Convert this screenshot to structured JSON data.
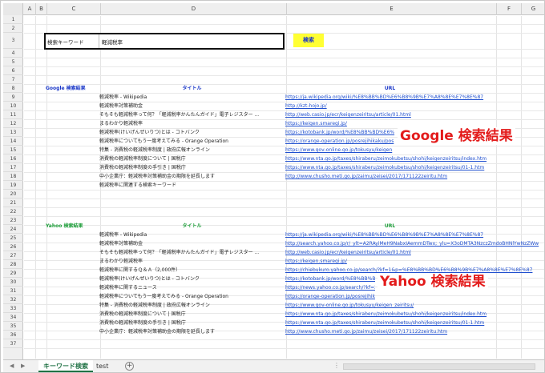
{
  "columns": [
    "A",
    "B",
    "C",
    "D",
    "E",
    "F",
    "G"
  ],
  "rows": [
    "1",
    "2",
    "3",
    "4",
    "5",
    "6",
    "7",
    "8",
    "9",
    "10",
    "11",
    "12",
    "13",
    "14",
    "15",
    "16",
    "17",
    "18",
    "19",
    "20",
    "21",
    "22",
    "23",
    "24",
    "25",
    "26",
    "27",
    "28",
    "29",
    "30",
    "31",
    "32",
    "33",
    "34",
    "35",
    "36",
    "37"
  ],
  "search": {
    "label": "検索キーワード",
    "value": "軽減税率",
    "button_label": "検索"
  },
  "google": {
    "section_label": "Google 検索結果",
    "title_header": "タイトル",
    "url_header": "URL",
    "overlay_label": "Google 検索結果",
    "results": [
      {
        "title": "軽減税率 - Wikipedia",
        "url": "https://ja.wikipedia.org/wiki/%E8%BB%BD%E6%B8%9B%E7%A8%8E%E7%8E%87"
      },
      {
        "title": "軽減税率対策補助金",
        "url": "http://kzt-hojo.jp/"
      },
      {
        "title": "そもそも軽減税率って何？「軽減税率かんたんガイド」電子レジスター ...",
        "url": "http://web.casio.jp/ecr/keigenzeiritsu/article/01.html"
      },
      {
        "title": "まるわかり軽減税率",
        "url": "https://keigen.smaregi.jp/"
      },
      {
        "title": "軽減税率(けいげんぜいりつ)とは - コトバンク",
        "url": "https://kotobank.jp/word/%E8%BB%BD%E6%"
      },
      {
        "title": "軽減税率についてもう一度考えてみる - Orange Operation",
        "url": "https://orange-operation.jp/posrejihikaku/pos"
      },
      {
        "title": "特集 - 消費税の軽減税率制度 | 政府広報オンライン",
        "url": "https://www.gov-online.go.jp/tokusyu/keigen"
      },
      {
        "title": "消費税の軽減税率制度について | 国税庁",
        "url": "https://www.nta.go.jp/taxes/shiraberu/zeimokubetsu/shohi/keigenzeiritsu/index.htm"
      },
      {
        "title": "消費税の軽減税率制度の手引き | 国税庁",
        "url": "https://www.nta.go.jp/taxes/shiraberu/zeimokubetsu/shohi/keigenzeiritsu/01-1.htm"
      },
      {
        "title": "中小企業庁：軽減税率対策補助金の期限を延長します",
        "url": "http://www.chusho.meti.go.jp/zaimu/zeisei/2017/171122zeiritu.htm"
      },
      {
        "title": "軽減税率に関連する検索キーワード",
        "url": ""
      }
    ]
  },
  "yahoo": {
    "section_label": "Yahoo 検索結果",
    "title_header": "タイトル",
    "url_header": "URL",
    "overlay_label": "Yahoo 検索結果",
    "results": [
      {
        "title": "軽減税率 - Wikipedia",
        "url": "https://ja.wikipedia.org/wiki/%E8%BB%BD%E6%B8%9B%E7%A8%8E%E7%8E%87"
      },
      {
        "title": "軽減税率対策補助金",
        "url": "http://search.yahoo.co.jp/r/_ylt=A2RAyiMeH9NabxIAemmDTwx;_ylu=X3oDMTA3NzczZmdoBHNlYwNzZWw"
      },
      {
        "title": "そもそも軽減税率って何？「軽減税率かんたんガイド」電子レジスター ...",
        "url": "http://web.casio.jp/ecr/keigenzeiritsu/article/01.html"
      },
      {
        "title": "まるわかり軽減税率",
        "url": "https://keigen.smaregi.jp/"
      },
      {
        "title": "軽減税率に関するＱ＆Ａ（2,000件）",
        "url": "https://chiebukuro.yahoo.co.jp/search/?kf=1&p=%E8%BB%BD%E6%B8%9B%E7%A8%8E%E7%8E%87"
      },
      {
        "title": "軽減税率(けいげんぜいりつ)とは - コトバンク",
        "url": "https://kotobank.jp/word/%E8%BB%BD"
      },
      {
        "title": "軽減税率に関するニュース",
        "url": "https://news.yahoo.co.jp/search/?kf=2&ei"
      },
      {
        "title": "軽減税率についてもう一度考えてみる - Orange Operation",
        "url": "https://orange-operation.jp/posrejihikaku/po"
      },
      {
        "title": "特集 - 消費税の軽減税率制度 | 政府広報オンライン",
        "url": "https://www.gov-online.go.jp/tokusyu/keigen_zeiritsu/"
      },
      {
        "title": "消費税の軽減税率制度について | 国税庁",
        "url": "https://www.nta.go.jp/taxes/shiraberu/zeimokubetsu/shohi/keigenzeiritsu/index.htm"
      },
      {
        "title": "消費税の軽減税率制度の手引き | 国税庁",
        "url": "https://www.nta.go.jp/taxes/shiraberu/zeimokubetsu/shohi/keigenzeiritsu/01-1.htm"
      },
      {
        "title": "中小企業庁：軽減税率対策補助金の期限を延長します",
        "url": "http://www.chusho.meti.go.jp/zaimu/zeisei/2017/171122zeiritu.htm"
      }
    ]
  },
  "tabs": {
    "active_label": "キーワード検索",
    "second_label": "test",
    "add_label": "+",
    "more_label": "⋮"
  },
  "colors": {
    "google_header": "#1a37c8",
    "yahoo_header": "#1e9e3a",
    "overlay_text": "#e31b1b",
    "search_button": "#ffff33"
  },
  "icons": {
    "prev_sheet": "triangle-left-icon",
    "next_sheet": "triangle-right-icon",
    "add_sheet": "plus-circle-icon"
  }
}
